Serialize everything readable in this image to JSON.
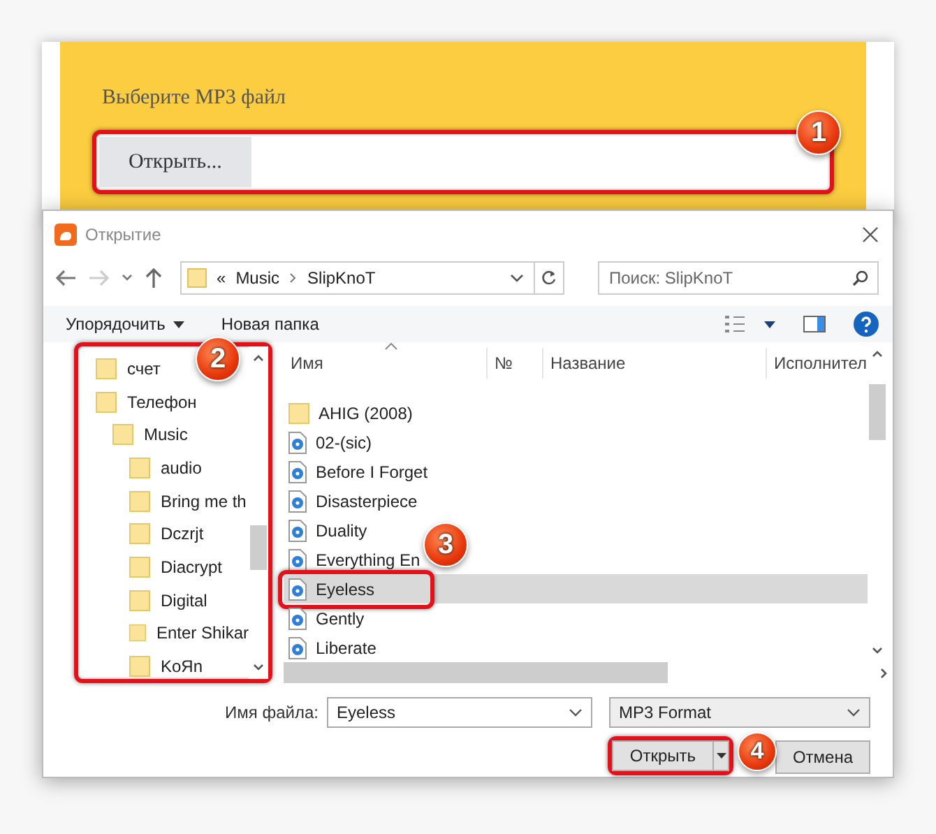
{
  "page": {
    "prompt": "Выберите MP3 файл",
    "file_button": "Открыть...",
    "highlighted": true
  },
  "dialog": {
    "title": "Открытие",
    "address": {
      "overflow": "«",
      "path": [
        "Music",
        "SlipKnoT"
      ]
    },
    "search": {
      "placeholder": "Поиск: SlipKnoT"
    },
    "toolbar": {
      "organize": "Упорядочить",
      "new_folder": "Новая папка"
    },
    "nav_highlighted": true,
    "nav_tree": [
      {
        "label": "счет"
      },
      {
        "label": "Телефон",
        "children": [
          {
            "label": "Music",
            "children": [
              {
                "label": "audio"
              },
              {
                "label": "Bring me th"
              },
              {
                "label": "Dczrjt"
              },
              {
                "label": "Diacrypt"
              },
              {
                "label": "Digital"
              },
              {
                "label": "Enter Shikar"
              },
              {
                "label": "KoЯn"
              }
            ]
          }
        ]
      }
    ],
    "columns": [
      "Имя",
      "№",
      "Название",
      "Исполнител"
    ],
    "files": [
      {
        "name": "AHIG (2008)",
        "kind": "folder",
        "selected": false,
        "highlighted": false
      },
      {
        "name": "02-(sic)",
        "kind": "audio",
        "selected": false,
        "highlighted": false
      },
      {
        "name": "Before I Forget",
        "kind": "audio",
        "selected": false,
        "highlighted": false
      },
      {
        "name": "Disasterpiece",
        "kind": "audio",
        "selected": false,
        "highlighted": false
      },
      {
        "name": "Duality",
        "kind": "audio",
        "selected": false,
        "highlighted": false
      },
      {
        "name": "Everything En",
        "kind": "audio",
        "selected": false,
        "highlighted": false
      },
      {
        "name": "Eyeless",
        "kind": "audio",
        "selected": true,
        "highlighted": true
      },
      {
        "name": "Gently",
        "kind": "audio",
        "selected": false,
        "highlighted": false
      },
      {
        "name": "Liberate",
        "kind": "audio",
        "selected": false,
        "highlighted": false
      }
    ],
    "filename_label": "Имя файла:",
    "filename": "Eyeless",
    "filetype": "MP3 Format",
    "open_button": {
      "label": "Открыть",
      "highlighted": true
    },
    "cancel_button": "Отмена"
  },
  "callouts": [
    "1",
    "2",
    "3",
    "4"
  ]
}
